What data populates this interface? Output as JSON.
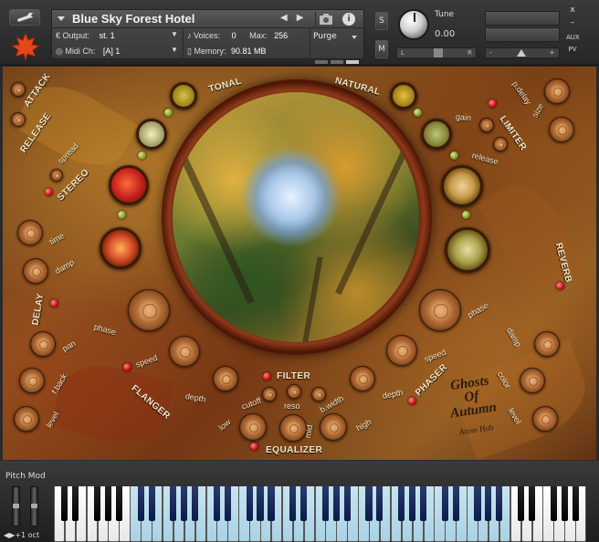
{
  "header": {
    "instrument_title": "Blue Sky Forest Hotel",
    "output_label": "Output:",
    "output_value": "st. 1",
    "midi_label": "Midi Ch:",
    "midi_value": "[A] 1",
    "voices_label": "Voices:",
    "voices_value": "0",
    "max_label": "Max:",
    "max_value": "256",
    "memory_label": "Memory:",
    "memory_value": "90.81 MB",
    "purge_label": "Purge",
    "solo_label": "S",
    "mute_label": "M",
    "tune_label": "Tune",
    "tune_value": "0.00",
    "pan_left": "L",
    "pan_right": "R",
    "vol_minus": "-",
    "vol_plus": "+",
    "close_label": "x",
    "minimize_label": "–",
    "aux_label": "AUX",
    "pv_label": "PV"
  },
  "panel": {
    "labels": {
      "attack": "ATTACK",
      "release_env": "RELEASE",
      "tonal": "TONAL",
      "natural": "NATURAL",
      "spread": "spread",
      "stereo": "STEREO",
      "time": "time",
      "damp_delay": "damp",
      "delay": "DELAY",
      "phase_delay": "phase",
      "pan": "pan",
      "fback": "f.back",
      "level_left": "level",
      "speed_flanger": "speed",
      "flanger": "FLANGER",
      "depth_flanger": "depth",
      "filter": "FILTER",
      "cutoff": "cutoff",
      "reso": "reso",
      "bwidth": "b.width",
      "low": "low",
      "mid": "mid",
      "high": "high",
      "equalizer": "EQUALIZER",
      "gain": "gain",
      "limiter": "LIMITER",
      "pdelay": "p.delay",
      "size": "size",
      "release_lim": "release",
      "reverb": "REVERB",
      "phase_reverb": "phase",
      "damp_reverb": "damp",
      "speed_phaser": "speed",
      "phaser": "PHASER",
      "depth_phaser": "depth",
      "color": "color",
      "level_right": "level"
    },
    "logo": {
      "line1": "Ghosts",
      "line2": "Of",
      "line3": "Autumn",
      "byline": "Atom Hub"
    }
  },
  "keyboard": {
    "pitch_mod_label": "Pitch Mod",
    "octave_label": "+1 oct"
  }
}
